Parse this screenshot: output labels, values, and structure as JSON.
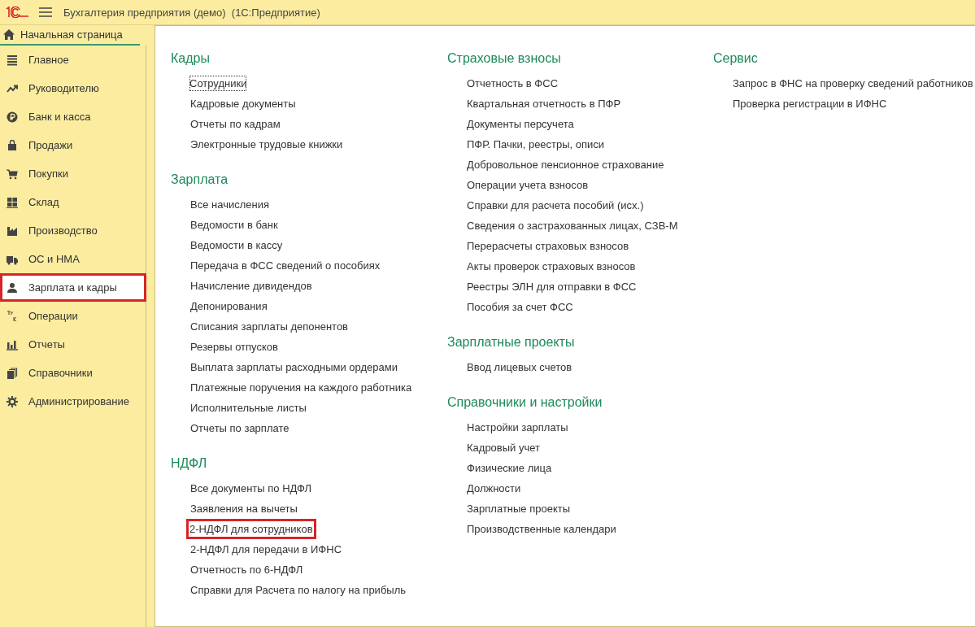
{
  "window": {
    "title": "Бухгалтерия предприятия (демо)  (1С:Предприятие)"
  },
  "tabs": [
    {
      "label": "Начальная страница",
      "selected": true
    }
  ],
  "sidebar": {
    "items": [
      {
        "label": "Главное",
        "selected": false,
        "highlighted": false
      },
      {
        "label": "Руководителю",
        "selected": false,
        "highlighted": false
      },
      {
        "label": "Банк и касса",
        "selected": false,
        "highlighted": false
      },
      {
        "label": "Продажи",
        "selected": false,
        "highlighted": false
      },
      {
        "label": "Покупки",
        "selected": false,
        "highlighted": false
      },
      {
        "label": "Склад",
        "selected": false,
        "highlighted": false
      },
      {
        "label": "Производство",
        "selected": false,
        "highlighted": false
      },
      {
        "label": "ОС и НМА",
        "selected": false,
        "highlighted": false
      },
      {
        "label": "Зарплата и кадры",
        "selected": true,
        "highlighted": true
      },
      {
        "label": "Операции",
        "selected": false,
        "highlighted": false
      },
      {
        "label": "Отчеты",
        "selected": false,
        "highlighted": false
      },
      {
        "label": "Справочники",
        "selected": false,
        "highlighted": false
      },
      {
        "label": "Администрирование",
        "selected": false,
        "highlighted": false
      }
    ]
  },
  "columns": [
    {
      "sections": [
        {
          "title": "Кадры",
          "links": [
            {
              "label": "Сотрудники",
              "focused": true,
              "highlighted": false
            },
            {
              "label": "Кадровые документы",
              "focused": false,
              "highlighted": false
            },
            {
              "label": "Отчеты по кадрам",
              "focused": false,
              "highlighted": false
            },
            {
              "label": "Электронные трудовые книжки",
              "focused": false,
              "highlighted": false
            }
          ]
        },
        {
          "title": "Зарплата",
          "links": [
            {
              "label": "Все начисления",
              "focused": false,
              "highlighted": false
            },
            {
              "label": "Ведомости в банк",
              "focused": false,
              "highlighted": false
            },
            {
              "label": "Ведомости в кассу",
              "focused": false,
              "highlighted": false
            },
            {
              "label": "Передача в ФСС сведений о пособиях",
              "focused": false,
              "highlighted": false
            },
            {
              "label": "Начисление дивидендов",
              "focused": false,
              "highlighted": false
            },
            {
              "label": "Депонирования",
              "focused": false,
              "highlighted": false
            },
            {
              "label": "Списания зарплаты депонентов",
              "focused": false,
              "highlighted": false
            },
            {
              "label": "Резервы отпусков",
              "focused": false,
              "highlighted": false
            },
            {
              "label": "Выплата зарплаты расходными ордерами",
              "focused": false,
              "highlighted": false
            },
            {
              "label": "Платежные поручения на каждого работника",
              "focused": false,
              "highlighted": false
            },
            {
              "label": "Исполнительные листы",
              "focused": false,
              "highlighted": false
            },
            {
              "label": "Отчеты по зарплате",
              "focused": false,
              "highlighted": false
            }
          ]
        },
        {
          "title": "НДФЛ",
          "links": [
            {
              "label": "Все документы по НДФЛ",
              "focused": false,
              "highlighted": false
            },
            {
              "label": "Заявления на вычеты",
              "focused": false,
              "highlighted": false
            },
            {
              "label": "2-НДФЛ для сотрудников",
              "focused": false,
              "highlighted": true
            },
            {
              "label": "2-НДФЛ для передачи в ИФНС",
              "focused": false,
              "highlighted": false
            },
            {
              "label": "Отчетность по 6-НДФЛ",
              "focused": false,
              "highlighted": false
            },
            {
              "label": "Справки для Расчета по налогу на прибыль",
              "focused": false,
              "highlighted": false
            }
          ]
        }
      ]
    },
    {
      "sections": [
        {
          "title": "Страховые взносы",
          "links": [
            {
              "label": "Отчетность в ФСС",
              "focused": false,
              "highlighted": false
            },
            {
              "label": "Квартальная отчетность в ПФР",
              "focused": false,
              "highlighted": false
            },
            {
              "label": "Документы персучета",
              "focused": false,
              "highlighted": false
            },
            {
              "label": "ПФР. Пачки, реестры, описи",
              "focused": false,
              "highlighted": false
            },
            {
              "label": "Добровольное пенсионное страхование",
              "focused": false,
              "highlighted": false
            },
            {
              "label": "Операции учета взносов",
              "focused": false,
              "highlighted": false
            },
            {
              "label": "Справки для расчета пособий (исх.)",
              "focused": false,
              "highlighted": false
            },
            {
              "label": "Сведения о застрахованных лицах, СЗВ-М",
              "focused": false,
              "highlighted": false
            },
            {
              "label": "Перерасчеты страховых взносов",
              "focused": false,
              "highlighted": false
            },
            {
              "label": "Акты проверок страховых взносов",
              "focused": false,
              "highlighted": false
            },
            {
              "label": "Реестры ЭЛН для отправки в ФСС",
              "focused": false,
              "highlighted": false
            },
            {
              "label": "Пособия за счет ФСС",
              "focused": false,
              "highlighted": false
            }
          ]
        },
        {
          "title": "Зарплатные проекты",
          "links": [
            {
              "label": "Ввод лицевых счетов",
              "focused": false,
              "highlighted": false
            }
          ]
        },
        {
          "title": "Справочники и настройки",
          "links": [
            {
              "label": "Настройки зарплаты",
              "focused": false,
              "highlighted": false
            },
            {
              "label": "Кадровый учет",
              "focused": false,
              "highlighted": false
            },
            {
              "label": "Физические лица",
              "focused": false,
              "highlighted": false
            },
            {
              "label": "Должности",
              "focused": false,
              "highlighted": false
            },
            {
              "label": "Зарплатные проекты",
              "focused": false,
              "highlighted": false
            },
            {
              "label": "Производственные календари",
              "focused": false,
              "highlighted": false
            }
          ]
        }
      ]
    },
    {
      "sections": [
        {
          "title": "Сервис",
          "links": [
            {
              "label": "Запрос в ФНС на проверку сведений работников",
              "focused": false,
              "highlighted": false
            },
            {
              "label": "Проверка регистрации в ИФНС",
              "focused": false,
              "highlighted": false
            }
          ]
        }
      ]
    }
  ]
}
